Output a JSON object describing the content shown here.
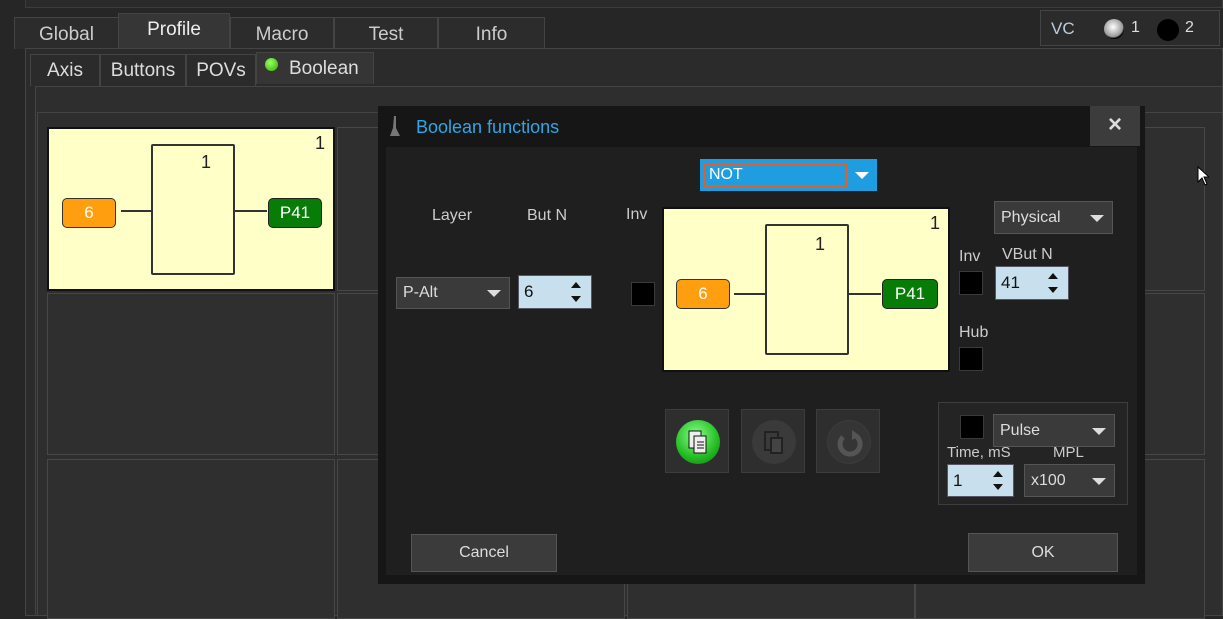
{
  "main_tabs": [
    "Global",
    "Profile",
    "Macro",
    "Test",
    "Info"
  ],
  "active_main_tab": "Profile",
  "vc": {
    "label": "VC",
    "options": [
      "1",
      "2"
    ],
    "selected": "1"
  },
  "sub_tabs": [
    "Axis",
    "Buttons",
    "POVs",
    "Boolean"
  ],
  "active_sub_tab": "Boolean",
  "grid_cell": {
    "index": "1",
    "gate_label": "1",
    "input": "6",
    "output": "P41"
  },
  "dialog": {
    "title": "Boolean functions",
    "close": "×",
    "function_select": "NOT",
    "layer_label": "Layer",
    "layer_value": "P-Alt",
    "butn_label": "But N",
    "butn_value": "6",
    "inv_label": "Inv",
    "gate": {
      "index": "1",
      "gate_label": "1",
      "input": "6",
      "output": "P41"
    },
    "output_type": "Physical",
    "out_inv_label": "Inv",
    "vbutn_label": "VBut N",
    "vbutn_value": "41",
    "hub_label": "Hub",
    "mode": "Pulse",
    "time_label": "Time, mS",
    "time_value": "1",
    "mpl_label": "MPL",
    "mpl_value": "x100",
    "cancel": "Cancel",
    "ok": "OK"
  },
  "colors": {
    "accent": "#1e9ee0",
    "input": "#ff9f10",
    "output": "#077c07",
    "gate_bg": "#ffffc8"
  }
}
